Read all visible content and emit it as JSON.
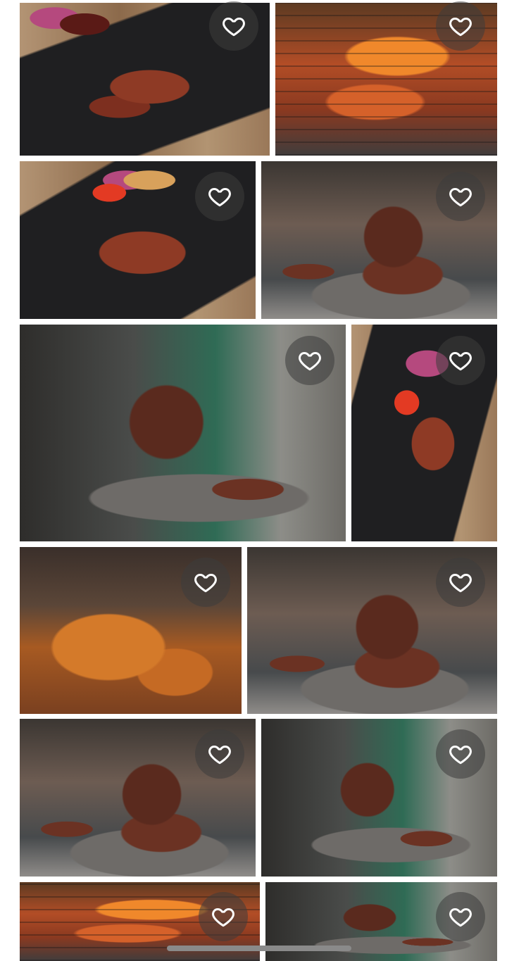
{
  "gallery": {
    "items": [
      {
        "name": "photo-skewers-slate-1",
        "style": "p-skewer-slate",
        "favorited": false
      },
      {
        "name": "photo-grill-orange",
        "style": "p-grill-orange",
        "favorited": false
      },
      {
        "name": "photo-skewers-slate-2",
        "style": "p-skewer-slate2",
        "favorited": false
      },
      {
        "name": "photo-suya-stack-1",
        "style": "p-stack",
        "favorited": false
      },
      {
        "name": "photo-suya-stack-large",
        "style": "p-stack-big",
        "favorited": false
      },
      {
        "name": "photo-skewers-vertical",
        "style": "p-skewer-vertical",
        "favorited": false
      },
      {
        "name": "photo-spiced-meat",
        "style": "p-spice",
        "favorited": false
      },
      {
        "name": "photo-suya-stack-2",
        "style": "p-stack",
        "favorited": false
      },
      {
        "name": "photo-suya-stack-3",
        "style": "p-stack",
        "favorited": false
      },
      {
        "name": "photo-suya-stack-4",
        "style": "p-stack-big",
        "favorited": false
      },
      {
        "name": "photo-grill-smoke",
        "style": "p-grill-orange",
        "favorited": false
      },
      {
        "name": "photo-suya-stack-5",
        "style": "p-stack-big",
        "favorited": false
      }
    ]
  },
  "icons": {
    "favorite": "heart-outline-icon"
  },
  "colors": {
    "heart_stroke": "#ffffff",
    "heart_button_bg": "rgba(60,60,60,0.55)"
  }
}
